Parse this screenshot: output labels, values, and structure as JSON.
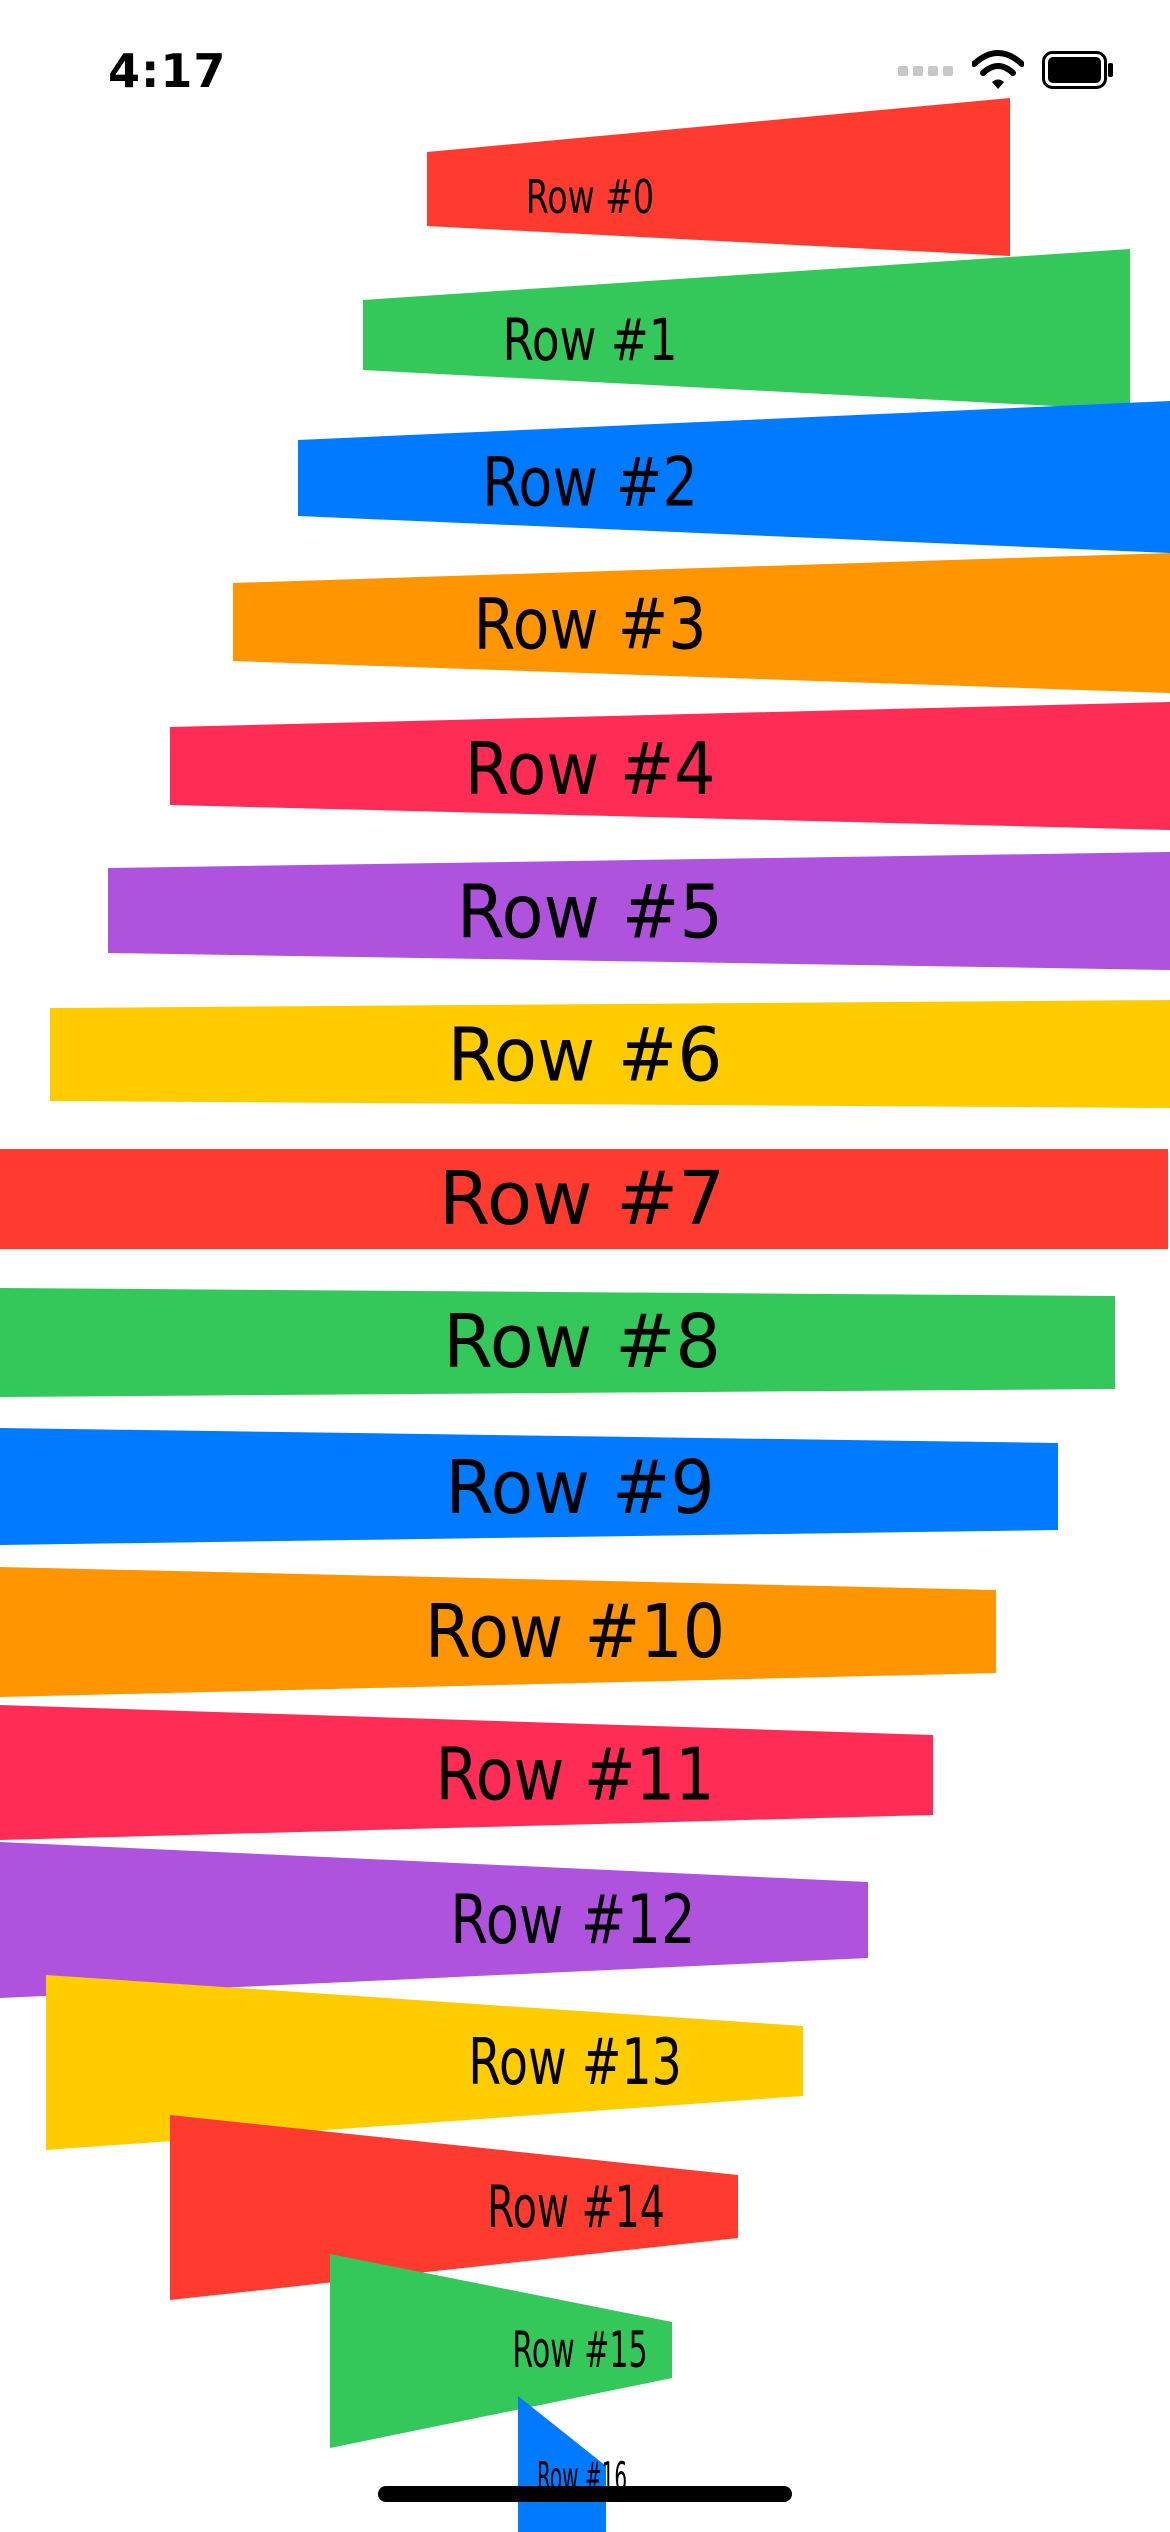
{
  "status_bar": {
    "time": "4:17",
    "icons": [
      "cellular-signal-icon",
      "wifi-icon",
      "battery-icon"
    ]
  },
  "rows": [
    {
      "label": "Row #0",
      "color": "#ff3b30"
    },
    {
      "label": "Row #1",
      "color": "#34c759"
    },
    {
      "label": "Row #2",
      "color": "#007aff"
    },
    {
      "label": "Row #3",
      "color": "#ff9500"
    },
    {
      "label": "Row #4",
      "color": "#ff2d55"
    },
    {
      "label": "Row #5",
      "color": "#af52de"
    },
    {
      "label": "Row #6",
      "color": "#ffcc00"
    },
    {
      "label": "Row #7",
      "color": "#ff3b30"
    },
    {
      "label": "Row #8",
      "color": "#34c759"
    },
    {
      "label": "Row #9",
      "color": "#007aff"
    },
    {
      "label": "Row #10",
      "color": "#ff9500"
    },
    {
      "label": "Row #11",
      "color": "#ff2d55"
    },
    {
      "label": "Row #12",
      "color": "#af52de"
    },
    {
      "label": "Row #13",
      "color": "#ffcc00"
    },
    {
      "label": "Row #14",
      "color": "#ff3b30"
    },
    {
      "label": "Row #15",
      "color": "#34c759"
    },
    {
      "label": "Row #16",
      "color": "#007aff"
    }
  ]
}
